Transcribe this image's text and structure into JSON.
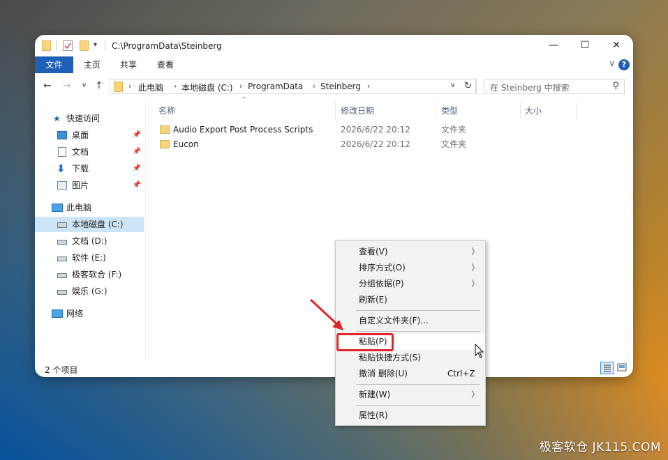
{
  "window": {
    "title": "C:\\ProgramData\\Steinberg",
    "controls": {
      "minimize": "—",
      "maximize": "☐",
      "close": "✕"
    }
  },
  "ribbon": {
    "tabs": [
      "文件",
      "主页",
      "共享",
      "查看"
    ],
    "help": "?",
    "expand": "∨"
  },
  "nav": {
    "back": "←",
    "forward": "→",
    "recent": "∨",
    "up": "↑",
    "breadcrumb": [
      "此电脑",
      "本地磁盘 (C:)",
      "ProgramData",
      "Steinberg"
    ],
    "refresh": "↻",
    "search_placeholder": "在 Steinberg 中搜索"
  },
  "sidebar": {
    "quick_access": "快速访问",
    "pinned": [
      {
        "label": "桌面",
        "icon": "desktop-icon"
      },
      {
        "label": "文档",
        "icon": "document-icon"
      },
      {
        "label": "下载",
        "icon": "download-icon"
      },
      {
        "label": "图片",
        "icon": "pictures-icon"
      }
    ],
    "this_pc": "此电脑",
    "drives": [
      "本地磁盘 (C:)",
      "文档 (D:)",
      "软件 (E:)",
      "极客软合 (F:)",
      "娱乐 (G:)"
    ],
    "network": "网络"
  },
  "columns": [
    "名称",
    "修改日期",
    "类型",
    "大小"
  ],
  "files": [
    {
      "name": "Audio Export Post Process Scripts",
      "date": "2026/6/22 20:12",
      "type": "文件夹"
    },
    {
      "name": "Eucon",
      "date": "2026/6/22 20:12",
      "type": "文件夹"
    }
  ],
  "status": "2 个项目",
  "context_menu": {
    "items": [
      {
        "label": "查看(V)",
        "submenu": true
      },
      {
        "label": "排序方式(O)",
        "submenu": true
      },
      {
        "label": "分组依据(P)",
        "submenu": true
      },
      {
        "label": "刷新(E)"
      },
      {
        "label": "自定义文件夹(F)..."
      },
      {
        "label": "粘贴(P)",
        "highlighted": true
      },
      {
        "label": "粘贴快捷方式(S)"
      },
      {
        "label": "撤消 删除(U)",
        "shortcut": "Ctrl+Z"
      },
      {
        "label": "新建(W)",
        "submenu": true
      },
      {
        "label": "属性(R)"
      }
    ]
  },
  "watermark": "极客软仓 JK115.COM",
  "colors": {
    "accent": "#1f5fb5",
    "selection": "#cce4f7",
    "highlight_box": "#e0252a",
    "arrow": "#e0252a"
  }
}
